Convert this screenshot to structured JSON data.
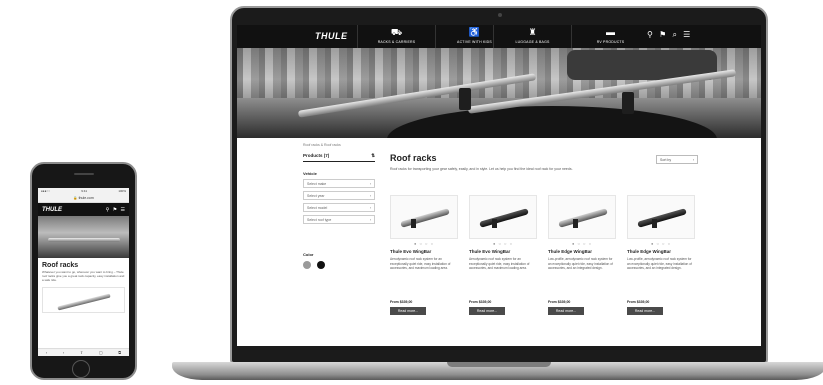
{
  "laptop": {
    "nav": {
      "brand": "THULE",
      "items": [
        {
          "label": "RACKS & CARRIERS",
          "icon": "car-rack-icon",
          "glyph": "⛟"
        },
        {
          "label": "ACTIVE WITH KIDS",
          "icon": "stroller-icon",
          "glyph": "♿"
        },
        {
          "label": "LUGGAGE & BAGS",
          "icon": "hiker-icon",
          "glyph": "♜"
        },
        {
          "label": "RV PRODUCTS",
          "icon": "camper-icon",
          "glyph": "▬"
        }
      ],
      "icons": "⚲ ⚑ ⌕ ☰"
    },
    "breadcrumb": "Roof racks & Roof racks",
    "sidebar": {
      "products_label": "Products (7)",
      "products_icon": "⇅",
      "vehicle_label": "Vehicle",
      "selects": [
        "Select make",
        "Select year",
        "Select model",
        "Select roof type"
      ],
      "color_label": "Color",
      "swatches": [
        "#9a9a9a",
        "#111111"
      ]
    },
    "title": "Roof racks",
    "description": "Roof racks for transporting your gear safely, easily, and in style. Let us help you find the ideal roof rack for your needs.",
    "sort_label": "Sort by",
    "products": [
      {
        "name": "Thule Evo WingBar",
        "desc": "Aerodynamic roof rack system for an exceptionally quiet ride, easy installation of accessories, and maximum loading area.",
        "price": "From $339,00",
        "button": "Read more..."
      },
      {
        "name": "Thule Evo WingBar",
        "desc": "Aerodynamic roof rack system for an exceptionally quiet ride, easy installation of accessories, and maximum loading area.",
        "price": "From $339,00",
        "button": "Read more..."
      },
      {
        "name": "Thule Edge WingBar",
        "desc": "Low-profile, aerodynamic roof rack system for an exceptionally quiet ride, easy installation of accessories, and an integrated design.",
        "price": "From $339,00",
        "button": "Read more..."
      },
      {
        "name": "Thule Edge WingBar",
        "desc": "Low-profile, aerodynamic roof rack system for an exceptionally quiet ride, easy installation of accessories, and an integrated design.",
        "price": "From $339,00",
        "button": "Read more..."
      }
    ]
  },
  "phone": {
    "status_time": "9:41",
    "status_left": "●●●○○",
    "status_right": "100%",
    "url": "🔒 thule.com",
    "brand": "THULE",
    "icons": "⚲ ⚑ ☰",
    "title": "Roof racks",
    "description": "Whatever you want to go, wherever you want to bring – Thule roof racks give you a great rack capacity, easy installation and a safe ride.",
    "toolbar": [
      "‹",
      "›",
      "⇪",
      "▢",
      "⧉"
    ]
  }
}
